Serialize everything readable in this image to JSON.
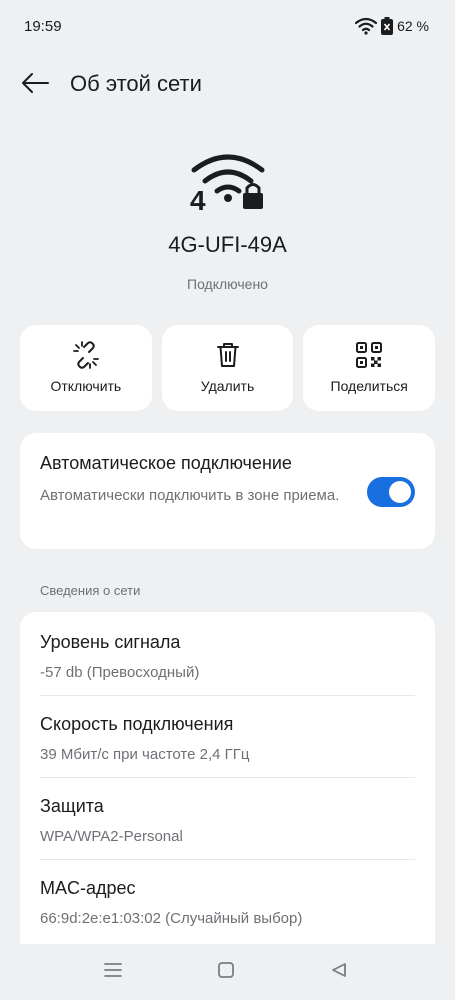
{
  "status_bar": {
    "time": "19:59",
    "battery": "62 %"
  },
  "header": {
    "title": "Об этой сети"
  },
  "network": {
    "icon_label": "4",
    "name": "4G-UFI-49A",
    "status": "Подключено"
  },
  "actions": [
    {
      "label": "Отключить",
      "icon": "unlink-icon"
    },
    {
      "label": "Удалить",
      "icon": "trash-icon"
    },
    {
      "label": "Поделиться",
      "icon": "qr-code-icon"
    }
  ],
  "auto_connect": {
    "title": "Автоматическое подключение",
    "description": "Автоматически подключить в зоне приема.",
    "enabled": true
  },
  "details": {
    "section_label": "Сведения о сети",
    "rows": [
      {
        "title": "Уровень сигнала",
        "value": "-57 db (Превосходный)"
      },
      {
        "title": "Скорость подключения",
        "value": "39 Мбит/с при частоте 2,4 ГГц"
      },
      {
        "title": "Защита",
        "value": "WPA/WPA2-Personal"
      },
      {
        "title": "MAC-адрес",
        "value": "66:9d:2e:e1:03:02 (Случайный выбор)"
      }
    ]
  },
  "colors": {
    "background": "#eef0f2",
    "card": "#ffffff",
    "accent": "#1a6fe0",
    "primary_text": "#1b1c1e",
    "secondary_text": "#6d7075"
  }
}
